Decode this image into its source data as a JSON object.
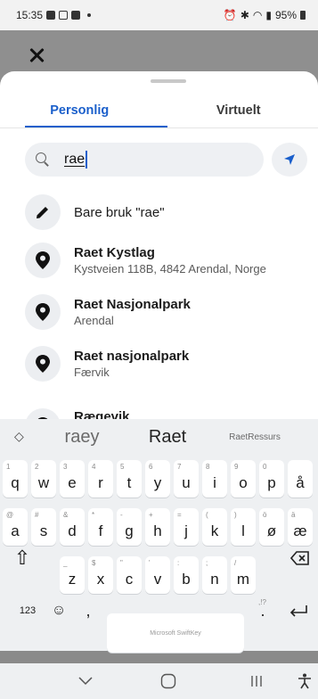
{
  "status": {
    "time": "15:35",
    "battery": "95%"
  },
  "tabs": {
    "personal": "Personlig",
    "virtual": "Virtuelt"
  },
  "search": {
    "value": "rae"
  },
  "results": {
    "use_text": "Bare bruk \"rae\"",
    "items": [
      {
        "title": "Raet Kystlag",
        "subtitle": "Kystveien 118B, 4842 Arendal, Norge"
      },
      {
        "title": "Raet Nasjonalpark",
        "subtitle": "Arendal"
      },
      {
        "title": "Raet nasjonalpark",
        "subtitle": "Færvik"
      },
      {
        "title": "Rægevik",
        "subtitle": ""
      }
    ]
  },
  "keyboard": {
    "suggestions": [
      "raey",
      "Raet",
      "RaetRessurs"
    ],
    "row1": [
      {
        "k": "q",
        "h": "1"
      },
      {
        "k": "w",
        "h": "2"
      },
      {
        "k": "e",
        "h": "3"
      },
      {
        "k": "r",
        "h": "4"
      },
      {
        "k": "t",
        "h": "5"
      },
      {
        "k": "y",
        "h": "6"
      },
      {
        "k": "u",
        "h": "7"
      },
      {
        "k": "i",
        "h": "8"
      },
      {
        "k": "o",
        "h": "9"
      },
      {
        "k": "p",
        "h": "0"
      },
      {
        "k": "å",
        "h": ""
      }
    ],
    "row2": [
      {
        "k": "a",
        "h": "@"
      },
      {
        "k": "s",
        "h": "#"
      },
      {
        "k": "d",
        "h": "&"
      },
      {
        "k": "f",
        "h": "*"
      },
      {
        "k": "g",
        "h": "-"
      },
      {
        "k": "h",
        "h": "+"
      },
      {
        "k": "j",
        "h": "="
      },
      {
        "k": "k",
        "h": "("
      },
      {
        "k": "l",
        "h": ")"
      },
      {
        "k": "ø",
        "h": "ö"
      },
      {
        "k": "æ",
        "h": "ä"
      }
    ],
    "row3": [
      {
        "k": "z",
        "h": "_"
      },
      {
        "k": "x",
        "h": "$"
      },
      {
        "k": "c",
        "h": "\""
      },
      {
        "k": "v",
        "h": "'"
      },
      {
        "k": "b",
        "h": ":"
      },
      {
        "k": "n",
        "h": ";"
      },
      {
        "k": "m",
        "h": "/"
      }
    ],
    "numbers_label": "123",
    "comma": ",",
    "period": ".",
    "period_hint": ",!?",
    "space_label": "Microsoft SwiftKey"
  }
}
